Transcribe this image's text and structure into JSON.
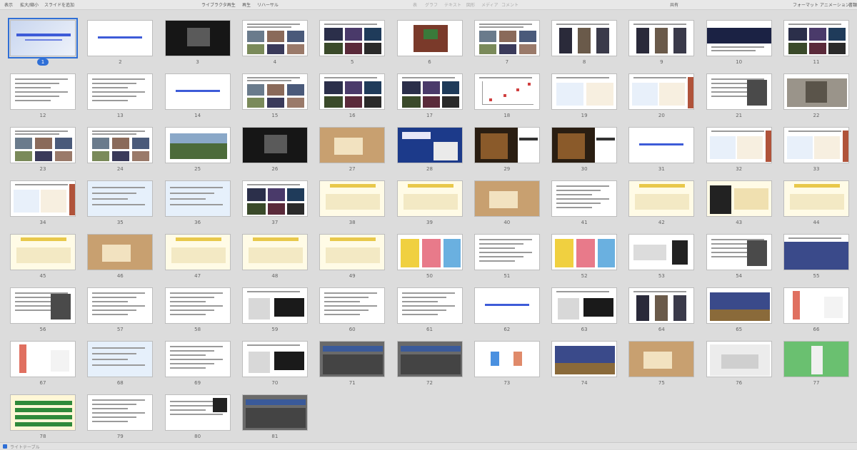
{
  "toolbar": {
    "items": [
      "表示",
      "拡大/縮小",
      "スライドを追加",
      "ライブラクタ再生",
      "再生",
      "リハーサル",
      "表",
      "グラフ",
      "テキスト",
      "図形",
      "メディア",
      "コメント",
      "共有",
      "フォーマット",
      "アニメーション",
      "書類"
    ]
  },
  "slides": {
    "count": 81,
    "selected": "1",
    "numbers": [
      "1",
      "2",
      "3",
      "4",
      "5",
      "6",
      "7",
      "8",
      "9",
      "10",
      "11",
      "12",
      "13",
      "14",
      "15",
      "16",
      "17",
      "18",
      "19",
      "20",
      "21",
      "22",
      "23",
      "24",
      "25",
      "26",
      "27",
      "28",
      "29",
      "30",
      "31",
      "32",
      "33",
      "34",
      "35",
      "36",
      "37",
      "38",
      "39",
      "40",
      "41",
      "42",
      "43",
      "44",
      "45",
      "46",
      "47",
      "48",
      "49",
      "50",
      "51",
      "52",
      "53",
      "54",
      "55",
      "56",
      "57",
      "58",
      "59",
      "60",
      "61",
      "62",
      "63",
      "64",
      "65",
      "66",
      "67",
      "68",
      "69",
      "70",
      "71",
      "72",
      "73",
      "74",
      "75",
      "76",
      "77",
      "78",
      "79",
      "80",
      "81"
    ]
  },
  "statusbar": {
    "text": "ライトテーブル"
  },
  "colors": {
    "accent": "#2f6fd6",
    "title_blue": "#3d5bd8"
  }
}
